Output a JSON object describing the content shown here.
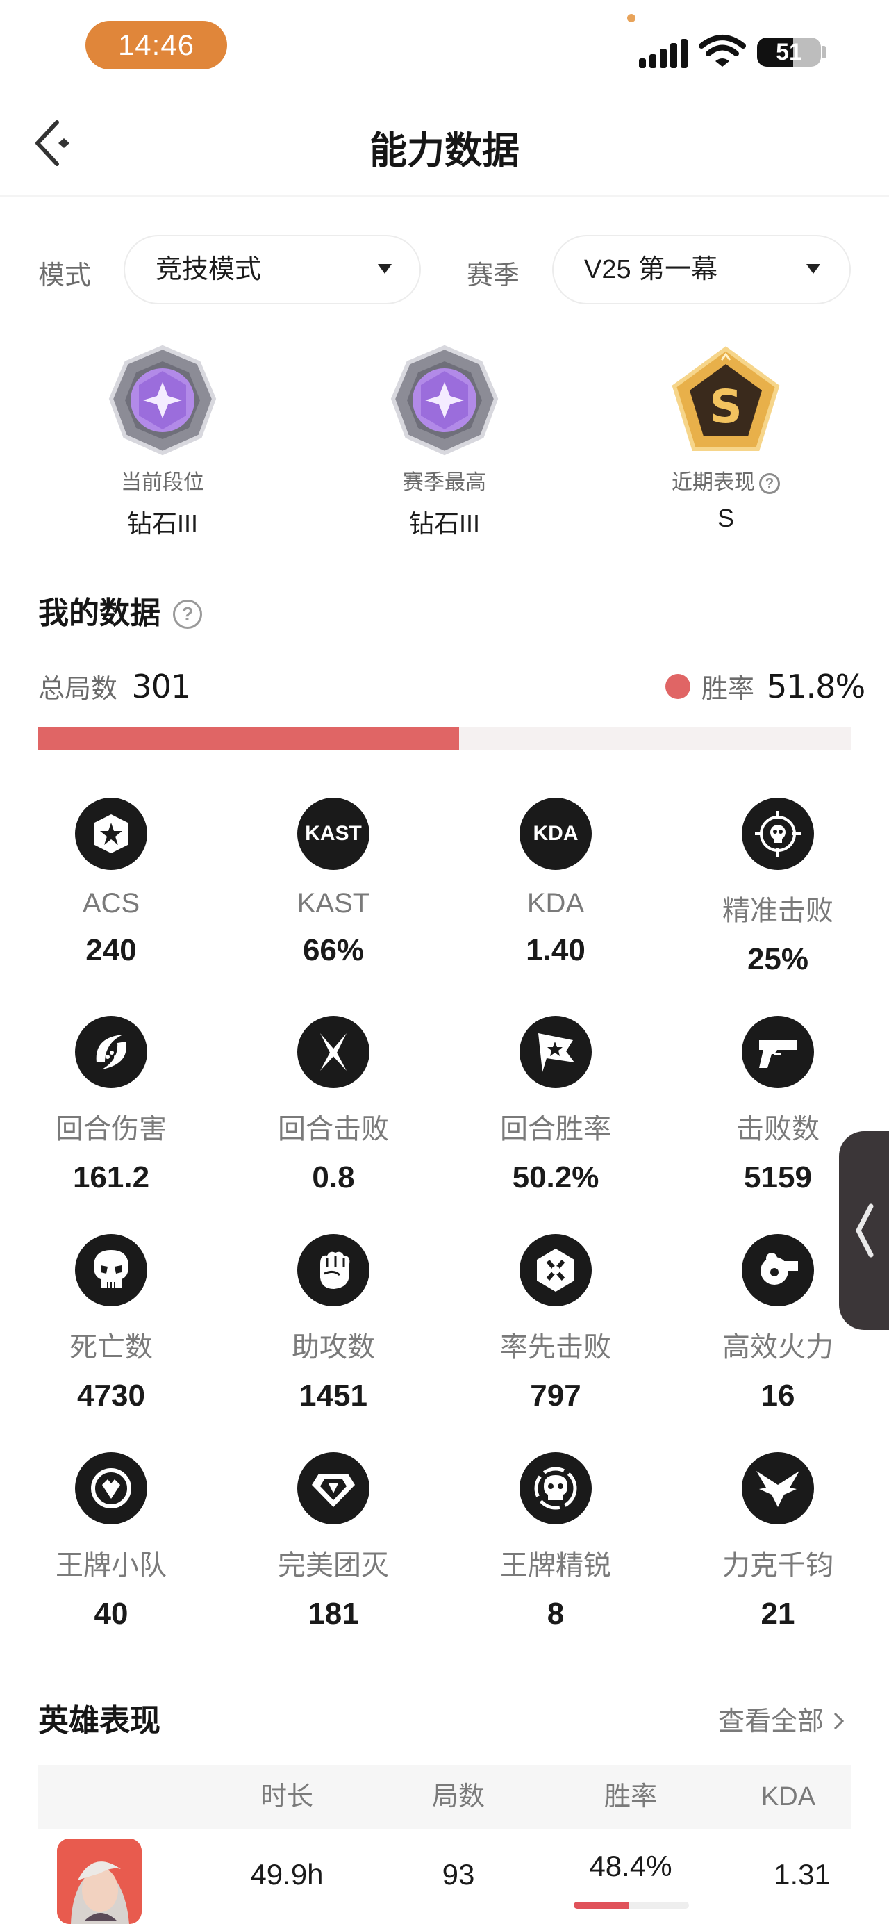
{
  "status_bar": {
    "time": "14:46",
    "battery": "51"
  },
  "header": {
    "title": "能力数据"
  },
  "filters": {
    "mode_label": "模式",
    "mode_value": "竞技模式",
    "season_label": "赛季",
    "season_value": "V25 第一幕"
  },
  "ranks": [
    {
      "caption": "当前段位",
      "value": "钻石III"
    },
    {
      "caption": "赛季最高",
      "value": "钻石III"
    },
    {
      "caption": "近期表现",
      "value": "S",
      "badge_letter": "S"
    }
  ],
  "my_data": {
    "title": "我的数据",
    "total_label": "总局数",
    "total_value": "301",
    "winrate_label": "胜率",
    "winrate_value": "51.8%",
    "winrate_fraction": 0.518,
    "colors": {
      "win": "#e06565"
    }
  },
  "stats": [
    {
      "icon": "star-badge-icon",
      "icon_text": "",
      "label": "ACS",
      "value": "240"
    },
    {
      "icon": "kast-icon",
      "icon_text": "KAST",
      "label": "KAST",
      "value": "66%"
    },
    {
      "icon": "kda-icon",
      "icon_text": "KDA",
      "label": "KDA",
      "value": "1.40"
    },
    {
      "icon": "crosshair-skull-icon",
      "icon_text": "",
      "label": "精准击败",
      "value": "25%"
    },
    {
      "icon": "slash-damage-icon",
      "icon_text": "",
      "label": "回合伤害",
      "value": "161.2"
    },
    {
      "icon": "crossed-blades-icon",
      "icon_text": "",
      "label": "回合击败",
      "value": "0.8"
    },
    {
      "icon": "flag-star-icon",
      "icon_text": "",
      "label": "回合胜率",
      "value": "50.2%"
    },
    {
      "icon": "pistol-icon",
      "icon_text": "",
      "label": "击败数",
      "value": "5159"
    },
    {
      "icon": "skull-icon",
      "icon_text": "",
      "label": "死亡数",
      "value": "4730"
    },
    {
      "icon": "fist-icon",
      "icon_text": "",
      "label": "助攻数",
      "value": "1451"
    },
    {
      "icon": "first-blood-icon",
      "icon_text": "",
      "label": "率先击败",
      "value": "797"
    },
    {
      "icon": "heavy-weapon-icon",
      "icon_text": "",
      "label": "高效火力",
      "value": "16"
    },
    {
      "icon": "ace-squad-icon",
      "icon_text": "",
      "label": "王牌小队",
      "value": "40"
    },
    {
      "icon": "diamond-icon",
      "icon_text": "",
      "label": "完美团灭",
      "value": "181"
    },
    {
      "icon": "ace-skull-icon",
      "icon_text": "",
      "label": "王牌精锐",
      "value": "8"
    },
    {
      "icon": "winged-icon",
      "icon_text": "",
      "label": "力克千钧",
      "value": "21"
    }
  ],
  "heroes": {
    "title": "英雄表现",
    "view_all": "查看全部",
    "columns": [
      "时长",
      "局数",
      "胜率",
      "KDA"
    ],
    "rows": [
      {
        "hours": "49.9h",
        "matches": "93",
        "winrate": "48.4%",
        "winrate_fraction": 0.484,
        "kda": "1.31"
      }
    ]
  }
}
